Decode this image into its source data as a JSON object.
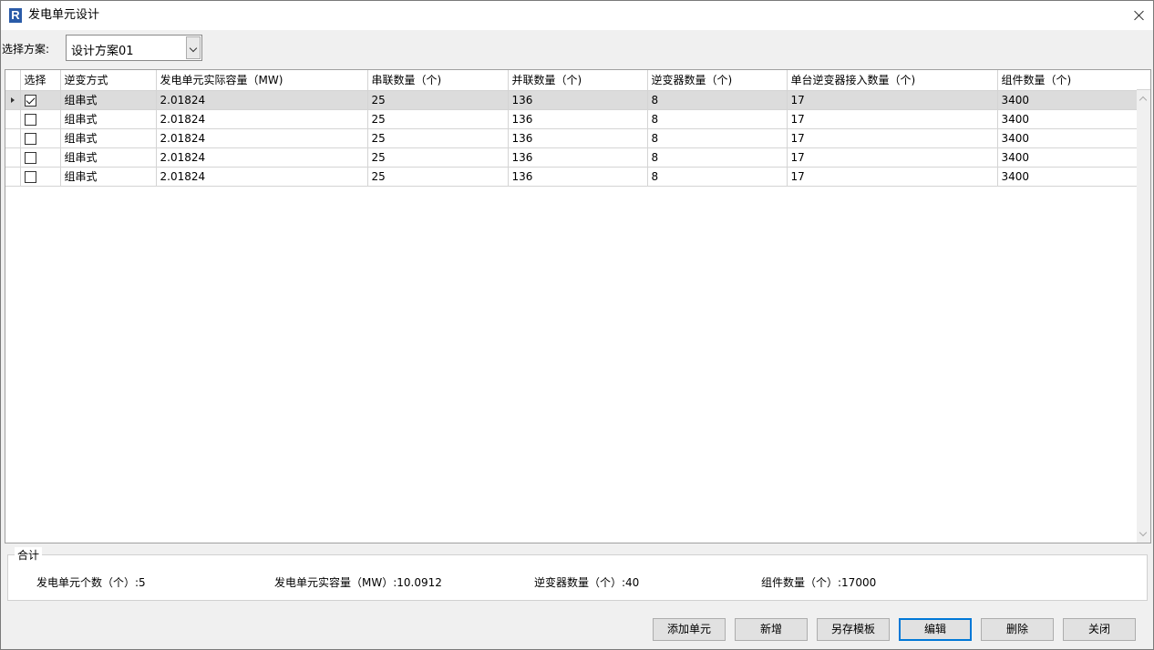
{
  "window": {
    "title": "发电单元设计"
  },
  "scheme": {
    "label": "选择方案:",
    "value": "设计方案01"
  },
  "table": {
    "columns": [
      "选择",
      "逆变方式",
      "发电单元实际容量（MW)",
      "串联数量（个)",
      "并联数量（个)",
      "逆变器数量（个)",
      "单台逆变器接入数量（个)",
      "组件数量（个)"
    ],
    "rows": [
      {
        "checked": true,
        "mode": "组串式",
        "capacity": "2.01824",
        "series": "25",
        "parallel": "136",
        "inverters": "8",
        "per_inverter": "17",
        "modules": "3400"
      },
      {
        "checked": false,
        "mode": "组串式",
        "capacity": "2.01824",
        "series": "25",
        "parallel": "136",
        "inverters": "8",
        "per_inverter": "17",
        "modules": "3400"
      },
      {
        "checked": false,
        "mode": "组串式",
        "capacity": "2.01824",
        "series": "25",
        "parallel": "136",
        "inverters": "8",
        "per_inverter": "17",
        "modules": "3400"
      },
      {
        "checked": false,
        "mode": "组串式",
        "capacity": "2.01824",
        "series": "25",
        "parallel": "136",
        "inverters": "8",
        "per_inverter": "17",
        "modules": "3400"
      },
      {
        "checked": false,
        "mode": "组串式",
        "capacity": "2.01824",
        "series": "25",
        "parallel": "136",
        "inverters": "8",
        "per_inverter": "17",
        "modules": "3400"
      }
    ]
  },
  "summary": {
    "legend": "合计",
    "unit_count": "发电单元个数（个）:5",
    "total_capacity": "发电单元实容量（MW）:10.0912",
    "inverter_count": "逆变器数量（个）:40",
    "module_count": "组件数量（个）:17000"
  },
  "buttons": {
    "add_unit": "添加单元",
    "new": "新增",
    "save_template": "另存模板",
    "edit": "编辑",
    "delete": "删除",
    "close": "关闭"
  }
}
